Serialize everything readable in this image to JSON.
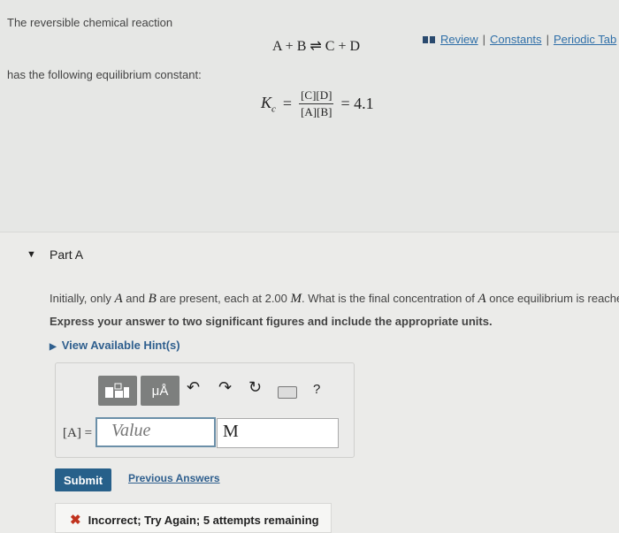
{
  "intro": {
    "line1": "The reversible chemical reaction",
    "reaction": "A + B ⇌ C + D",
    "line2": "has the following equilibrium constant:",
    "kc_symbol": "K",
    "kc_subscript": "c",
    "kc_numerator": "[C][D]",
    "kc_denominator": "[A][B]",
    "kc_value": "= 4.1"
  },
  "links": {
    "review": "Review",
    "constants": "Constants",
    "periodic": "Periodic Tab"
  },
  "partA": {
    "title": "Part A",
    "question_pre": "Initially, only ",
    "var_A": "A",
    "question_and": " and ",
    "var_B": "B",
    "question_mid": " are present, each at 2.00 ",
    "var_M": "M",
    "question_post": ". What is the final concentration of ",
    "var_A2": "A",
    "question_end": " once equilibrium is reached?",
    "instruction": "Express your answer to two significant figures and include the appropriate units.",
    "hints": "View Available Hint(s)"
  },
  "answer": {
    "label": "[A] =",
    "value_placeholder": "Value",
    "unit_value": "M",
    "mu_label": "μÅ",
    "help": "?"
  },
  "actions": {
    "submit": "Submit",
    "previous": "Previous Answers"
  },
  "feedback": {
    "icon": "✖",
    "text": "Incorrect; Try Again; 5 attempts remaining"
  }
}
